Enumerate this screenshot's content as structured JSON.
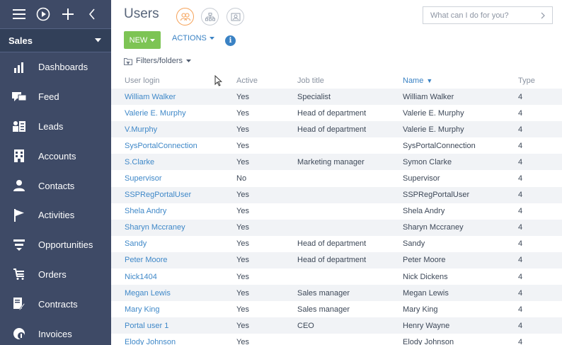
{
  "sidebar": {
    "workspace": "Sales",
    "items": [
      {
        "label": "Dashboards",
        "icon": "bar-chart-icon"
      },
      {
        "label": "Feed",
        "icon": "chat-icon"
      },
      {
        "label": "Leads",
        "icon": "lead-icon"
      },
      {
        "label": "Accounts",
        "icon": "building-icon"
      },
      {
        "label": "Contacts",
        "icon": "person-icon"
      },
      {
        "label": "Activities",
        "icon": "flag-icon"
      },
      {
        "label": "Opportunities",
        "icon": "funnel-icon"
      },
      {
        "label": "Orders",
        "icon": "cart-icon"
      },
      {
        "label": "Contracts",
        "icon": "contract-icon"
      },
      {
        "label": "Invoices",
        "icon": "invoice-icon"
      }
    ]
  },
  "header": {
    "title": "Users",
    "search_placeholder": "What can I do for you?"
  },
  "toolbar": {
    "new_label": "NEW",
    "actions_label": "ACTIONS",
    "filters_label": "Filters/folders"
  },
  "grid": {
    "columns": [
      "User login",
      "Active",
      "Job title",
      "Name",
      "Type"
    ],
    "rows": [
      [
        "William Walker",
        "Yes",
        "Specialist",
        "William Walker",
        "4"
      ],
      [
        "Valerie E. Murphy",
        "Yes",
        "Head of department",
        "Valerie E. Murphy",
        "4"
      ],
      [
        "V.Murphy",
        "Yes",
        "Head of department",
        "Valerie E. Murphy",
        "4"
      ],
      [
        "SysPortalConnection",
        "Yes",
        "",
        "SysPortalConnection",
        "4"
      ],
      [
        "S.Clarke",
        "Yes",
        "Marketing manager",
        "Symon Clarke",
        "4"
      ],
      [
        "Supervisor",
        "No",
        "",
        "Supervisor",
        "4"
      ],
      [
        "SSPRegPortalUser",
        "Yes",
        "",
        "SSPRegPortalUser",
        "4"
      ],
      [
        "Shela Andry",
        "Yes",
        "",
        "Shela Andry",
        "4"
      ],
      [
        "Sharyn Mccraney",
        "Yes",
        "",
        "Sharyn Mccraney",
        "4"
      ],
      [
        "Sandy",
        "Yes",
        "Head of department",
        "Sandy",
        "4"
      ],
      [
        "Peter Moore",
        "Yes",
        "Head of department",
        "Peter Moore",
        "4"
      ],
      [
        "Nick1404",
        "Yes",
        "",
        "Nick Dickens",
        "4"
      ],
      [
        "Megan Lewis",
        "Yes",
        "Sales manager",
        "Megan Lewis",
        "4"
      ],
      [
        "Mary King",
        "Yes",
        "Sales manager",
        "Mary King",
        "4"
      ],
      [
        "Portal user 1",
        "Yes",
        "CEO",
        "Henry Wayne",
        "4"
      ],
      [
        "Elody Johnson",
        "Yes",
        "",
        "Elody Johnson",
        "4"
      ]
    ]
  },
  "colors": {
    "sidebar_bg": "#3e4a66",
    "new_button": "#7dc454",
    "link": "#3f88c8",
    "accent_orange": "#f5a35a"
  }
}
